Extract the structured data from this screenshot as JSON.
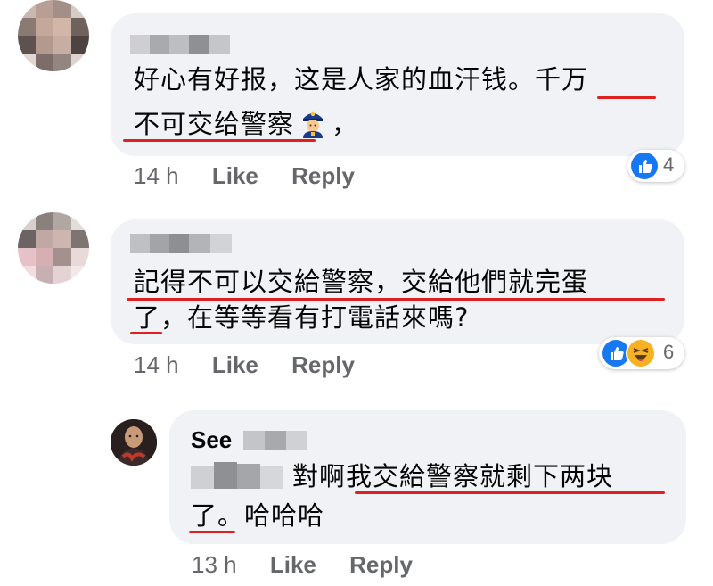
{
  "comments": [
    {
      "text_line1": "好心有好报，这是人家的血汗钱。千万",
      "text_line2": "不可交给警察",
      "text_line2_suffix": "，",
      "emoji": "police-officer-emoji",
      "time": "14 h",
      "like_label": "Like",
      "reply_label": "Reply",
      "reaction_count": "4",
      "reactions": [
        "like"
      ]
    },
    {
      "text_line1": "記得不可以交給警察，交給他們就完蛋",
      "text_line2": "了，在等等看有打電話來嗎?",
      "time": "14 h",
      "like_label": "Like",
      "reply_label": "Reply",
      "reaction_count": "6",
      "reactions": [
        "like",
        "haha"
      ]
    }
  ],
  "reply": {
    "author_visible": "See",
    "text_line1": "對啊我交給警察就剩下两块",
    "text_line2": "了。哈哈哈",
    "time": "13 h",
    "like_label": "Like",
    "reply_label": "Reply"
  },
  "colors": {
    "bubble": "#f0f2f5",
    "underline": "#e02020",
    "meta_text": "#65676b",
    "like_blue": "#1877f2",
    "haha_yellow": "#f7b125"
  }
}
